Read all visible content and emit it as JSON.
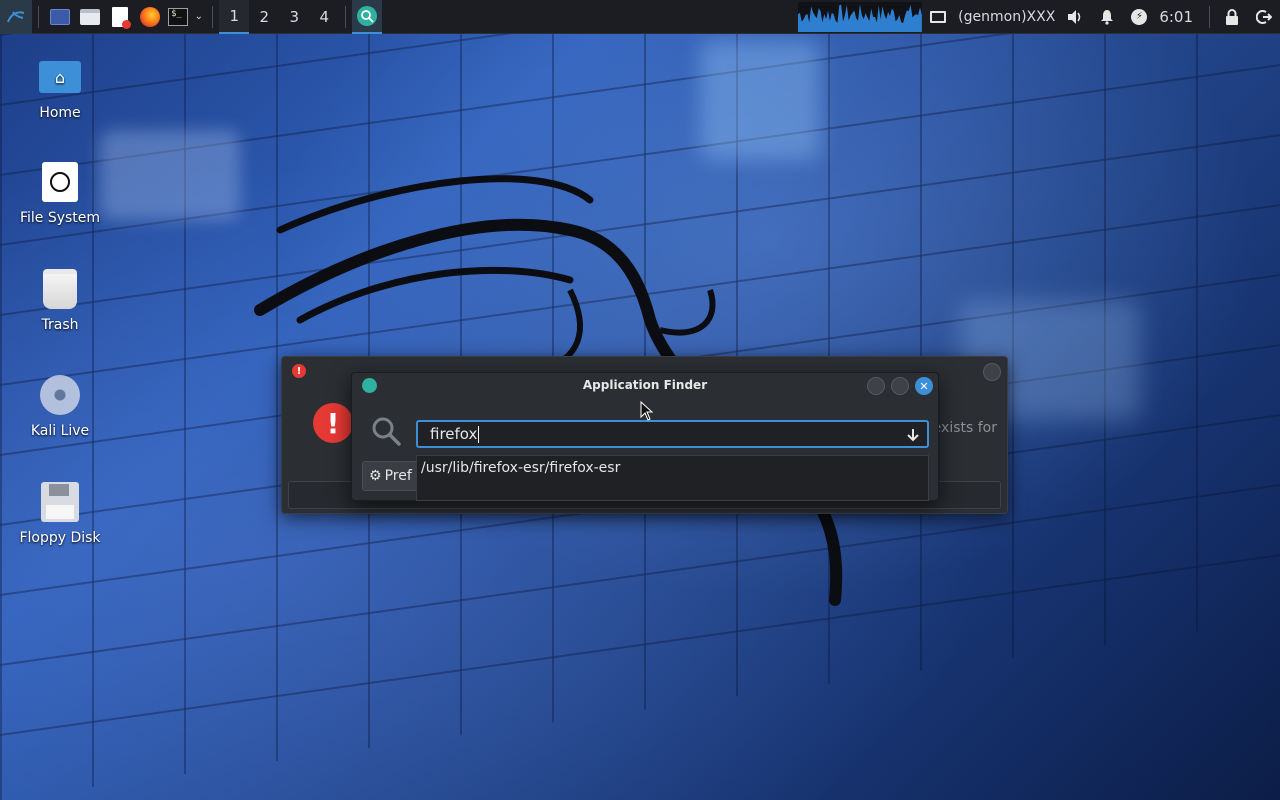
{
  "panel": {
    "workspaces": [
      "1",
      "2",
      "3",
      "4"
    ],
    "active_workspace": "1",
    "genmon": "(genmon)XXX",
    "clock": "6:01"
  },
  "desktop": {
    "icons": [
      {
        "label": "Home",
        "icon": "home-folder-icon"
      },
      {
        "label": "File System",
        "icon": "drive-icon"
      },
      {
        "label": "Trash",
        "icon": "trash-icon"
      },
      {
        "label": "Kali Live",
        "icon": "disc-icon"
      },
      {
        "label": "Floppy Disk",
        "icon": "floppy-icon"
      }
    ]
  },
  "error_dialog": {
    "hint_text": "exists for"
  },
  "app_finder": {
    "title": "Application Finder",
    "search_value": "firefox",
    "suggestion": "/usr/lib/firefox-esr/firefox-esr",
    "preferences_label": "Pref"
  },
  "colors": {
    "accent": "#3d8fd8",
    "panel_bg": "#1b1d22",
    "dialog_bg": "#2b2e33",
    "error_red": "#e53935"
  }
}
